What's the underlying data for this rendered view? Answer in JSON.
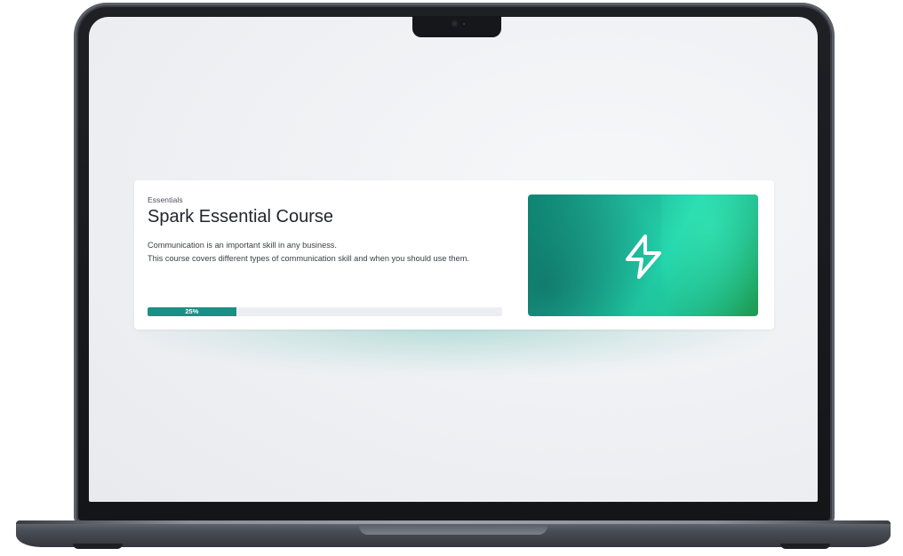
{
  "course": {
    "category": "Essentials",
    "title": "Spark Essential Course",
    "description_lines": [
      "Communication is an important skill in any business.",
      "This course covers different types of communication skill and when you should use them."
    ],
    "progress": {
      "percent": 25,
      "label": "25%"
    },
    "thumbnail_icon": "lightning-bolt-icon"
  },
  "colors": {
    "accent": "#1b8f86",
    "thumbnail_start": "#0f8a76",
    "thumbnail_mid": "#22d3aa",
    "thumbnail_end": "#1d9a4f"
  }
}
